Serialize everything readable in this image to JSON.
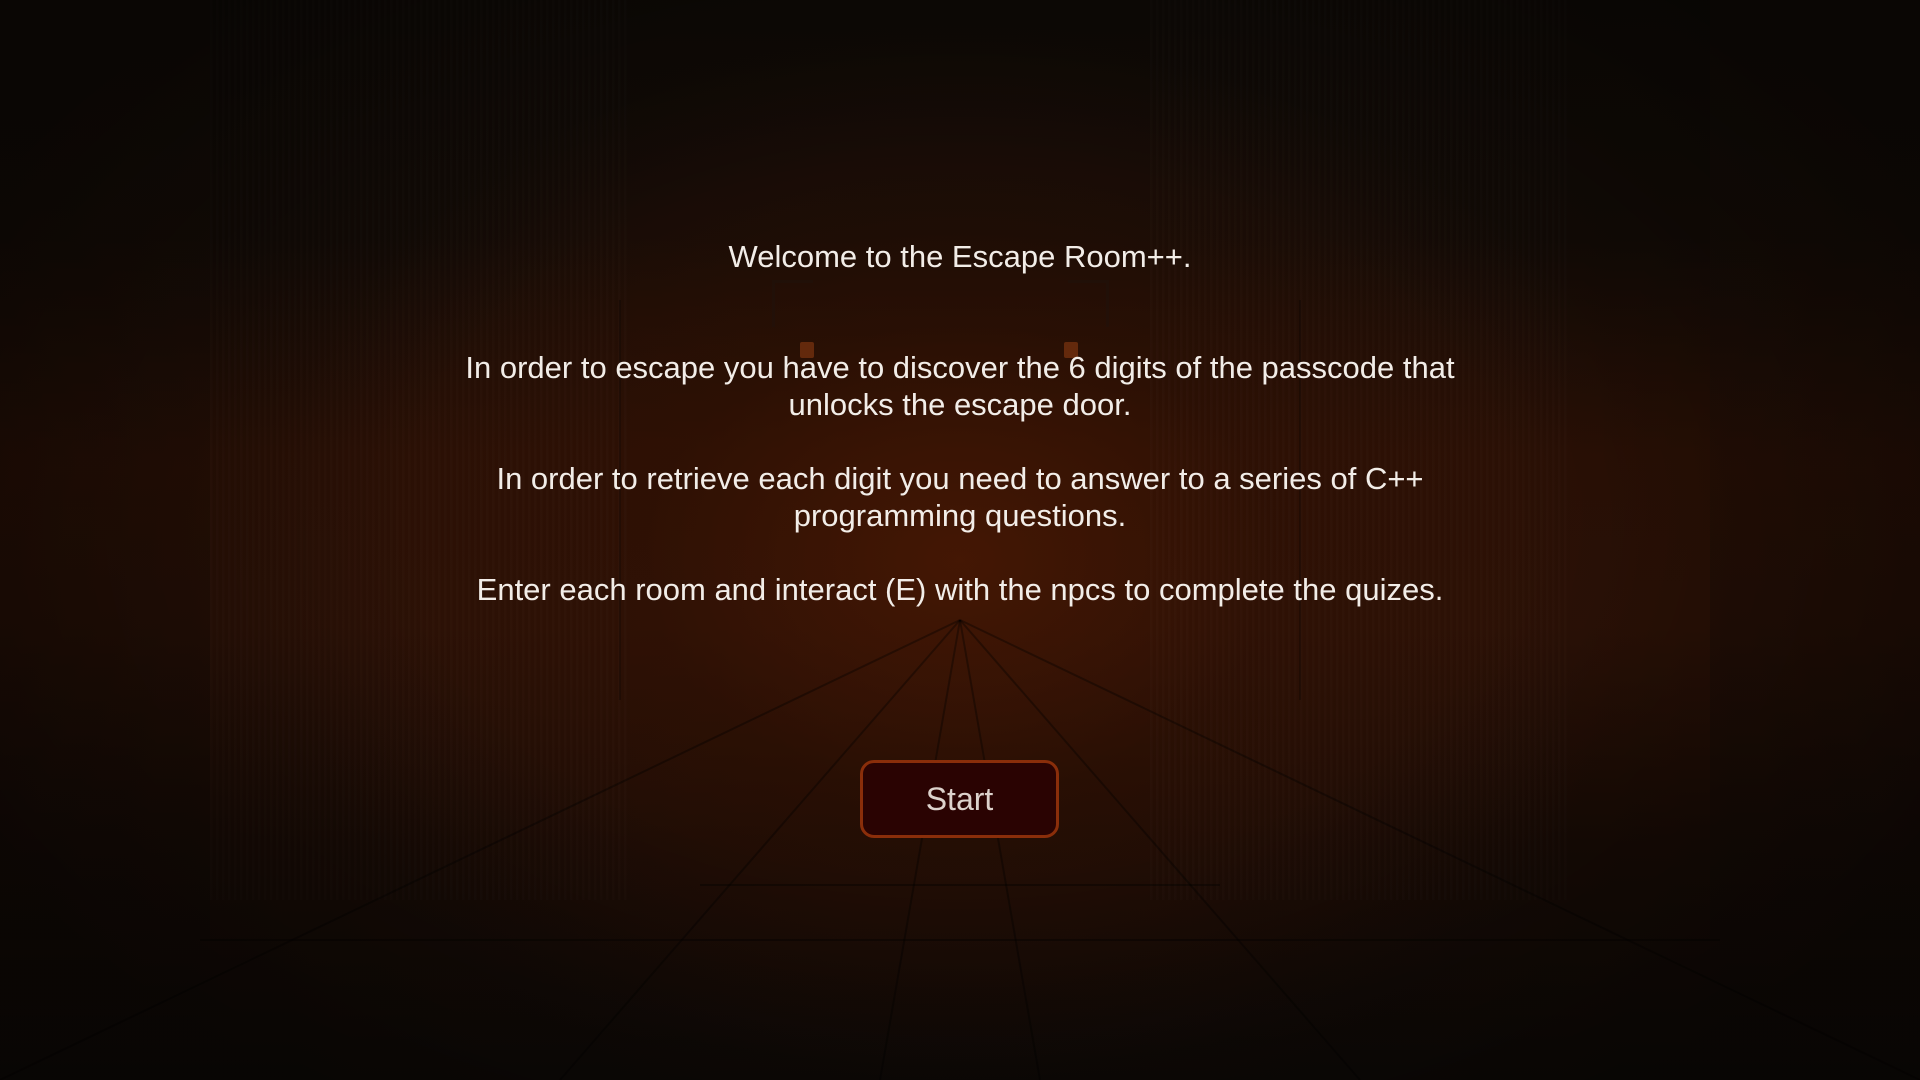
{
  "intro": {
    "title": "Welcome to the Escape Room++.",
    "paragraphs": [
      "In order to escape you have to discover the 6 digits of the passcode that unlocks the escape door.",
      "In order to retrieve each digit you need to answer to a series of C++ programming questions.",
      "Enter each room and interact (E) with the npcs to complete the quizes."
    ]
  },
  "start_button": {
    "label": "Start"
  },
  "colors": {
    "text": "#f2ede8",
    "button_bg": "#2a0302",
    "button_border": "#8a2e0a",
    "ambient_orange": "#482804"
  }
}
